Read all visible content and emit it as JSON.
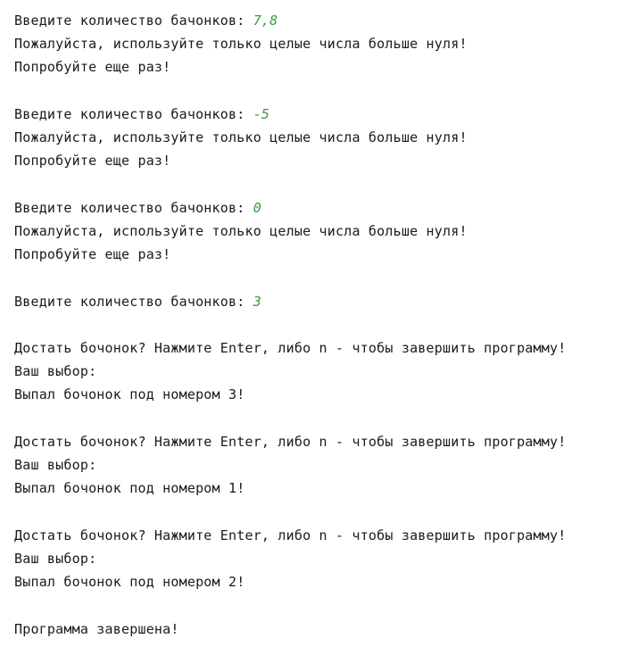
{
  "console": {
    "lines": [
      {
        "text": "Введите количество бачонков: ",
        "input": "7,8"
      },
      {
        "text": "Пожалуйста, используйте только целые числа больше нуля!"
      },
      {
        "text": "Попробуйте еще раз!"
      },
      {
        "text": "Введите количество бачонков: ",
        "input": "-5"
      },
      {
        "text": "Пожалуйста, используйте только целые числа больше нуля!"
      },
      {
        "text": "Попробуйте еще раз!"
      },
      {
        "text": "Введите количество бачонков: ",
        "input": "0"
      },
      {
        "text": "Пожалуйста, используйте только целые числа больше нуля!"
      },
      {
        "text": "Попробуйте еще раз!"
      },
      {
        "text": "Введите количество бачонков: ",
        "input": "3"
      },
      {
        "text": "Достать бочонок? Нажмите Enter, либо n - чтобы завершить программу!"
      },
      {
        "text": "Ваш выбор:"
      },
      {
        "text": "Выпал бочонок под номером 3!"
      },
      {
        "text": "Достать бочонок? Нажмите Enter, либо n - чтобы завершить программу!"
      },
      {
        "text": "Ваш выбор:"
      },
      {
        "text": "Выпал бочонок под номером 1!"
      },
      {
        "text": "Достать бочонок? Нажмите Enter, либо n - чтобы завершить программу!"
      },
      {
        "text": "Ваш выбор:"
      },
      {
        "text": "Выпал бочонок под номером 2!"
      },
      {
        "text": "Программа завершена!"
      }
    ]
  }
}
